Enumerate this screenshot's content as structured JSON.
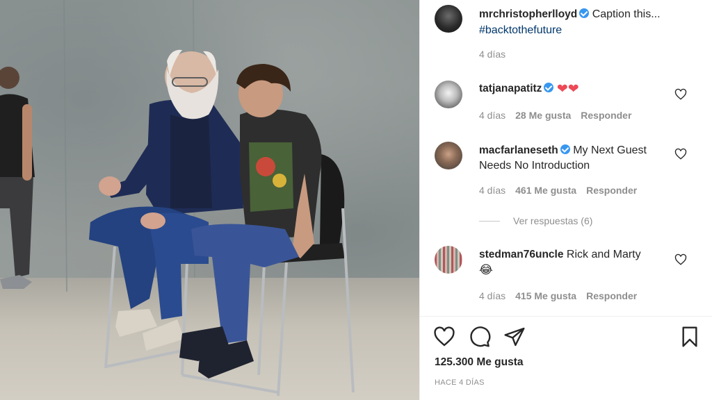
{
  "post": {
    "author": "mrchristopherlloyd",
    "caption": "Caption this...",
    "hashtag": "#backtothefuture",
    "time": "4 días"
  },
  "comments": [
    {
      "user": "tatjanapatitz",
      "text": "",
      "emoji": "❤❤",
      "time": "4 días",
      "likes": "28 Me gusta",
      "reply": "Responder"
    },
    {
      "user": "macfarlaneseth",
      "text_line1": "My Next Guest",
      "text_line2": "Needs No Introduction",
      "time": "4 días",
      "likes": "461 Me gusta",
      "reply": "Responder",
      "view_replies": "Ver respuestas (6)"
    },
    {
      "user": "stedman76uncle",
      "text": "Rick and Marty",
      "emoji": "😂",
      "time": "4 días",
      "likes": "415 Me gusta",
      "reply": "Responder"
    }
  ],
  "actions": {
    "like": "heart-icon",
    "comment": "comment-bubble-icon",
    "share": "paper-plane-icon",
    "save": "bookmark-icon"
  },
  "likes_total": "125.300 Me gusta",
  "posted": "HACE 4 DÍAS",
  "colors": {
    "link": "#00376b",
    "verified": "#3897f0",
    "muted": "#8e8e8e",
    "heart": "#ed4956"
  }
}
